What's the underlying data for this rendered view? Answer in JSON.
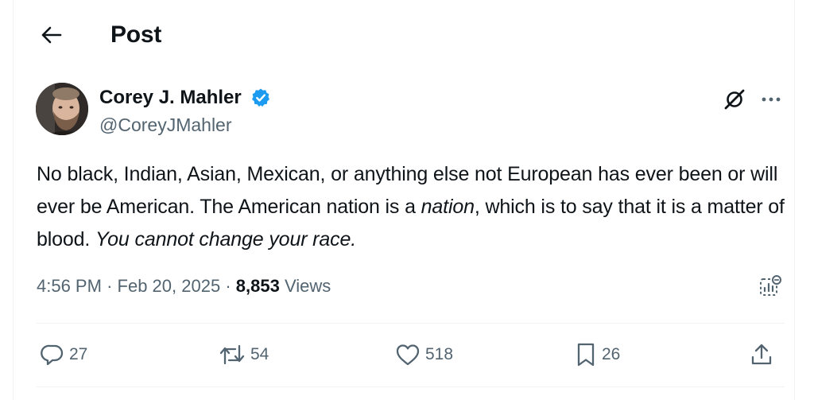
{
  "header": {
    "title": "Post"
  },
  "author": {
    "name": "Corey J. Mahler",
    "handle": "@CoreyJMahler",
    "verified": true
  },
  "tweet": {
    "segments": [
      {
        "text": "No black, Indian, Asian, Mexican, or anything else not European has ever been or will ever be American. The American nation is a ",
        "italic": false
      },
      {
        "text": "nation",
        "italic": true
      },
      {
        "text": ", which is to say that it is a matter of blood. ",
        "italic": false
      },
      {
        "text": "You cannot change your race.",
        "italic": true
      }
    ]
  },
  "meta": {
    "time": "4:56 PM",
    "separator": "·",
    "date": "Feb 20, 2025",
    "views_count": "8,853",
    "views_label": "Views"
  },
  "actions": {
    "replies": "27",
    "reposts": "54",
    "likes": "518",
    "bookmarks": "26"
  },
  "colors": {
    "text_primary": "#0f1419",
    "text_secondary": "#536471",
    "verified_blue": "#1d9bf0",
    "divider": "#eff3f4"
  },
  "icons": {
    "back": "arrow-left-icon",
    "verified": "verified-badge-icon",
    "grok": "grok-icon",
    "more": "more-horizontal-icon",
    "analytics": "post-analytics-icon",
    "reply": "reply-icon",
    "repost": "repost-icon",
    "like": "heart-icon",
    "bookmark": "bookmark-icon",
    "share": "share-icon"
  }
}
